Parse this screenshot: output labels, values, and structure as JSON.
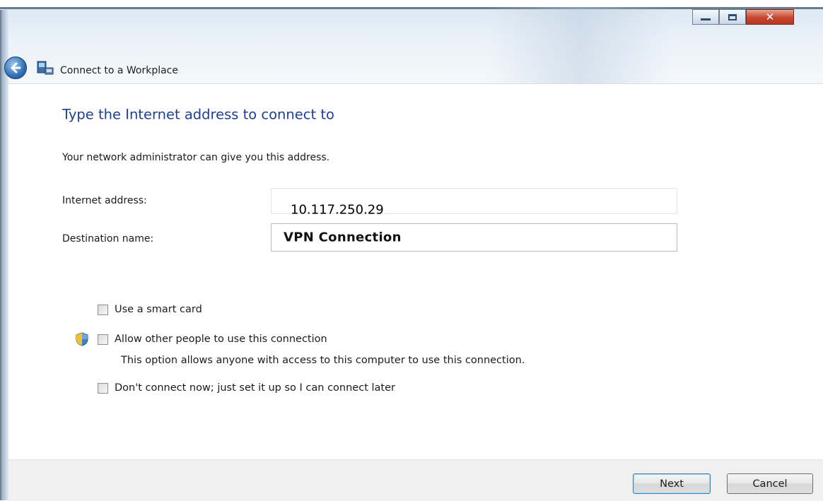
{
  "window": {
    "title": "Connect to a Workplace",
    "caption_buttons": [
      "minimize",
      "maximize",
      "close"
    ]
  },
  "nav": {
    "back_icon": "back-arrow-icon",
    "wizard_icon": "network-workplace-icon"
  },
  "page": {
    "heading": "Type the Internet address to connect to",
    "info": "Your network administrator can give you this address."
  },
  "fields": {
    "internet_address_label": "Internet address:",
    "internet_address_value": "10.117.250.29",
    "destination_name_label": "Destination name:",
    "destination_name_value": "VPN Connection"
  },
  "options": {
    "smart_card_label": "Use a smart card",
    "smart_card_checked": false,
    "allow_others_label": "Allow other people to use this connection",
    "allow_others_checked": false,
    "allow_others_desc": "This option allows anyone with access to this computer to use this connection.",
    "connect_later_label": "Don't connect now; just set it up so I can connect later",
    "connect_later_checked": false,
    "shield_icon": "uac-shield-icon"
  },
  "buttons": {
    "next": "Next",
    "cancel": "Cancel"
  },
  "colors": {
    "heading": "#1c3f93",
    "close_button": "#c7452d"
  }
}
